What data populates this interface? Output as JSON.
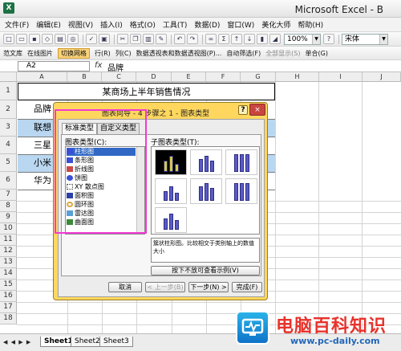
{
  "window": {
    "title": "Microsoft Excel - B"
  },
  "menu": [
    "文件(F)",
    "编辑(E)",
    "视图(V)",
    "插入(I)",
    "格式(O)",
    "工具(T)",
    "数据(D)",
    "窗口(W)",
    "美化大师",
    "帮助(H)"
  ],
  "toolbar1": {
    "zoom": "100%",
    "font": "宋体"
  },
  "toolbar2": {
    "items": [
      "范文库",
      "在线图片",
      "切换网格",
      "行(R)",
      "列(C)",
      "数据透视表和数据透视图(P)...",
      "自动筛选(F)",
      "全部显示(S)",
      "单合(G)"
    ],
    "active_index": 2
  },
  "namebox": "A2",
  "formula": "品牌",
  "columns": [
    "A",
    "B",
    "C",
    "D",
    "E",
    "F",
    "G",
    "H",
    "I",
    "J"
  ],
  "rows": [
    "1",
    "2",
    "3",
    "4",
    "5",
    "6",
    "7",
    "8",
    "9",
    "10",
    "11",
    "12",
    "13",
    "14",
    "15",
    "16",
    "17",
    "18"
  ],
  "cells": {
    "title": "某商场上半年销售情况",
    "A2": "品牌",
    "A3": "联想",
    "A4": "三星",
    "A5": "小米",
    "A6": "华为"
  },
  "sheets": [
    "Sheet1",
    "Sheet2",
    "Sheet3"
  ],
  "dialog": {
    "title": "图表向导 - 4 步骤之 1 - 图表类型",
    "help": "?",
    "close": "×",
    "tabs": [
      "标准类型",
      "自定义类型"
    ],
    "list_label": "图表类型(C):",
    "chart_types": [
      "柱形图",
      "条形图",
      "折线图",
      "饼图",
      "XY 散点图",
      "面积图",
      "圆环图",
      "雷达图",
      "曲面图"
    ],
    "selected_type": 0,
    "subtype_label": "子图表类型(T):",
    "description": "簇状柱形图。比较相交于类别轴上的数值大小",
    "preview_button": "按下不放可查看示例(V)",
    "buttons": [
      "取消",
      "< 上一步(B)",
      "下一步(N) >",
      "完成(F)"
    ]
  },
  "watermark": {
    "name": "电脑百科知识",
    "url": "www.pc-daily.com"
  }
}
